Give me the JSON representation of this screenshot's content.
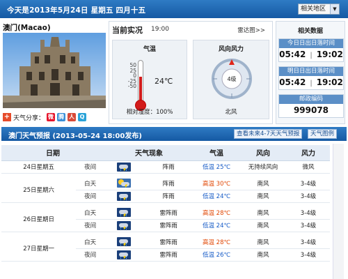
{
  "topbar": {
    "date_text": "今天是2013年5月24日 星期五 四月十五",
    "region_select": "相关地区"
  },
  "city": {
    "name": "澳门(Macao)",
    "share_label": "天气分享："
  },
  "current": {
    "title": "当前实况",
    "time": "19:00",
    "radar_link": "雷达图>>",
    "temperature_title": "气温",
    "temperature_value": "24℃",
    "thermo_scale": [
      "50",
      "25",
      "0",
      "-25",
      "-50"
    ],
    "humidity": "相对湿度：100%",
    "wind_title": "风向风力",
    "wind_level": "4级",
    "wind_direction": "北风"
  },
  "info": {
    "title": "相关数据",
    "today_label": "今日日出日落时间",
    "today_rise": "05:42",
    "today_set": "19:02",
    "tomorrow_label": "明日日出日落时间",
    "tomorrow_rise": "05:42",
    "tomorrow_set": "19:02",
    "postal_label": "邮政编码",
    "postal_code": "999078",
    "separator": "|"
  },
  "forecast": {
    "title": "澳门天气预报 (2013-05-24  18:00发布)",
    "btn_more": "查看未来4-7天天气预报",
    "btn_legend": "天气图例",
    "headers": [
      "日期",
      "天气现象",
      "气温",
      "风向",
      "风力"
    ],
    "rows": [
      {
        "day": "24日星期五",
        "period": "夜间",
        "icon": "thunder-shower-icon",
        "weather": "阵雨",
        "temp_label": "低温",
        "temp": "25℃",
        "wind_dir": "无持续风向",
        "wind_force": "微风"
      },
      {
        "day": "25日星期六",
        "period": "白天",
        "icon": "sun-thunder-icon",
        "weather": "阵雨",
        "temp_label": "高温",
        "temp": "30℃",
        "wind_dir": "南风",
        "wind_force": "3-4级"
      },
      {
        "day": "",
        "period": "夜间",
        "icon": "thunder-shower-icon",
        "weather": "阵雨",
        "temp_label": "低温",
        "temp": "24℃",
        "wind_dir": "南风",
        "wind_force": "3-4级"
      },
      {
        "day": "26日星期日",
        "period": "白天",
        "icon": "thunderstorm-icon",
        "weather": "雷阵雨",
        "temp_label": "高温",
        "temp": "28℃",
        "wind_dir": "南风",
        "wind_force": "3-4级"
      },
      {
        "day": "",
        "period": "夜间",
        "icon": "thunderstorm-icon",
        "weather": "雷阵雨",
        "temp_label": "低温",
        "temp": "24℃",
        "wind_dir": "南风",
        "wind_force": "3-4级"
      },
      {
        "day": "27日星期一",
        "period": "白天",
        "icon": "thunderstorm-icon",
        "weather": "雷阵雨",
        "temp_label": "高温",
        "temp": "28℃",
        "wind_dir": "南风",
        "wind_force": "3-4级"
      },
      {
        "day": "",
        "period": "夜间",
        "icon": "thunderstorm-icon",
        "weather": "雷阵雨",
        "temp_label": "低温",
        "temp": "26℃",
        "wind_dir": "南风",
        "wind_force": "3-4级"
      }
    ]
  },
  "colors": {
    "header_blue": "#1e6cb8",
    "high_temp": "#e04400",
    "low_temp": "#1258c6",
    "thermo_red": "#d21b1b"
  }
}
